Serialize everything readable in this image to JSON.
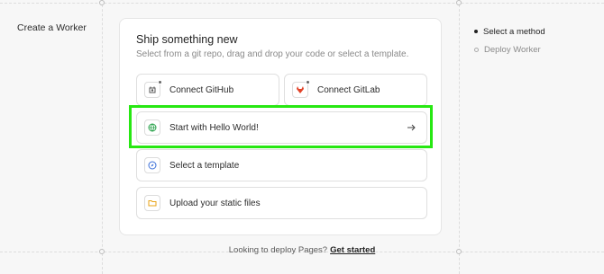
{
  "page": {
    "left_title": "Create a Worker"
  },
  "card": {
    "title": "Ship something new",
    "subtitle": "Select from a git repo, drag and drop your code or select a template."
  },
  "options": {
    "github": {
      "label": "Connect GitHub",
      "icon": "github-icon"
    },
    "gitlab": {
      "label": "Connect GitLab",
      "icon": "gitlab-icon"
    },
    "hello": {
      "label": "Start with Hello World!",
      "icon": "globe-icon"
    },
    "template": {
      "label": "Select a template",
      "icon": "compass-icon"
    },
    "upload": {
      "label": "Upload your static files",
      "icon": "folder-icon"
    }
  },
  "footer": {
    "text": "Looking to deploy Pages?",
    "link": "Get started"
  },
  "steps": [
    {
      "label": "Select a method",
      "active": true
    },
    {
      "label": "Deploy Worker",
      "active": false
    }
  ],
  "colors": {
    "highlight": "#27e812",
    "globe": "#2ea44f",
    "compass": "#3b6fd8",
    "folder": "#e8a317",
    "gitlab": "#e24329"
  }
}
